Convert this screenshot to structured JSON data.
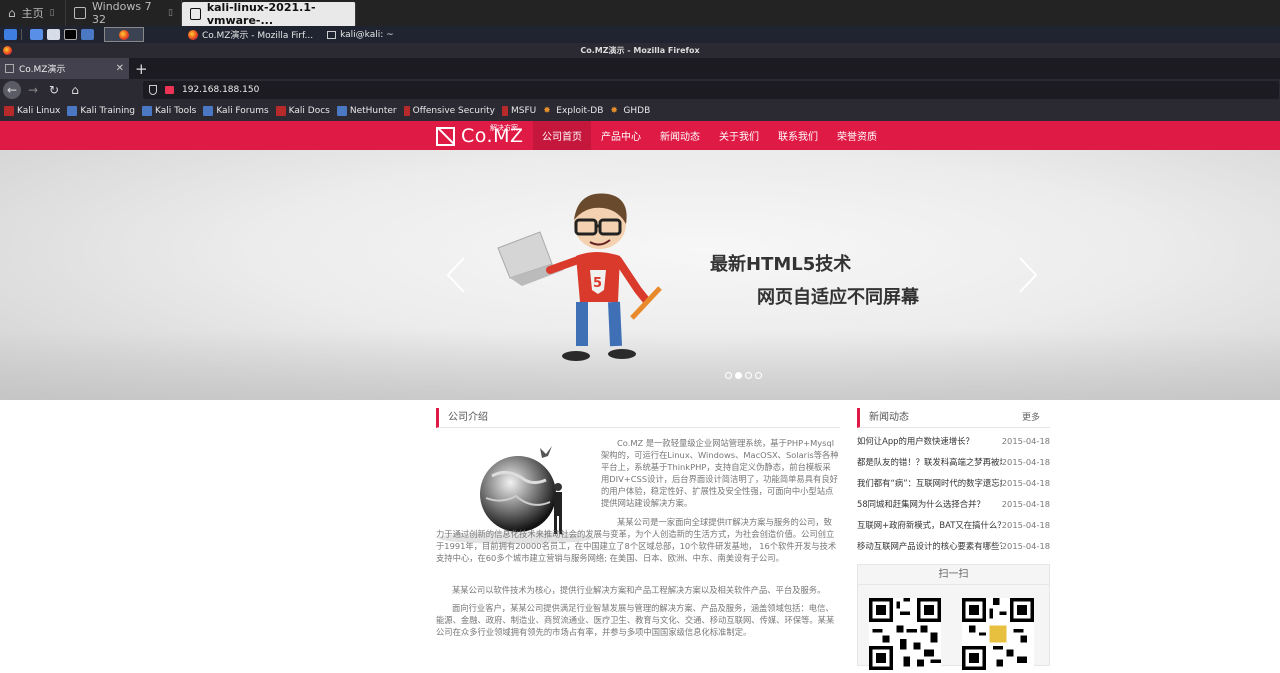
{
  "vm_tabs": [
    {
      "label": "主页"
    },
    {
      "label": "Windows 7 32"
    },
    {
      "label": "kali-linux-2021.1-vmware-..."
    }
  ],
  "taskbar": {
    "firefox_task": "Co.MZ演示 - Mozilla Firf...",
    "terminal_task": "kali@kali: ~"
  },
  "browser": {
    "window_title": "Co.MZ演示 - Mozilla Firefox",
    "tab_title": "Co.MZ演示",
    "url": "192.168.188.150",
    "bookmarks": [
      "Kali Linux",
      "Kali Training",
      "Kali Tools",
      "Kali Forums",
      "Kali Docs",
      "NetHunter",
      "Offensive Security",
      "MSFU",
      "Exploit-DB",
      "GHDB"
    ]
  },
  "site": {
    "logo_text": "Co.MZ",
    "logo_sub": "解决方案",
    "nav": [
      "公司首页",
      "产品中心",
      "新闻动态",
      "关于我们",
      "联系我们",
      "荣誉资质"
    ],
    "banner": {
      "line1": "最新HTML5技术",
      "line2": "网页自适应不同屏幕",
      "slide_count": 4,
      "active_slide": 2
    },
    "about": {
      "heading": "公司介绍",
      "p1": "Co.MZ 是一款轻量级企业网站管理系统，基于PHP+Mysql架构的，可运行在Linux、Windows、MacOSX、Solaris等各种平台上，系统基于ThinkPHP，支持自定义伪静态，前台模板采用DIV+CSS设计，后台界面设计简洁明了，功能简单易具有良好的用户体验，稳定性好、扩展性及安全性强，可面向中小型站点提供网站建设解决方案。",
      "p2": "某某公司是一家面向全球提供IT解决方案与服务的公司，致力于通过创新的信息化技术来推动社会的发展与变革，为个人创造新的生活方式，为社会创造价值。公司创立于1991年，目前拥有20000名员工，在中国建立了8个区域总部，10个软件研发基地， 16个软件开发与技术支持中心，在60多个城市建立营销与服务网络; 在美国、日本、欧洲、中东、南美设有子公司。",
      "p3": "某某公司以软件技术为核心，提供行业解决方案和产品工程解决方案以及相关软件产品、平台及服务。",
      "p4": "面向行业客户，某某公司提供满足行业智慧发展与管理的解决方案、产品及服务，涵盖领域包括：电信、能源、金融、政府、制造业、商贸流通业、医疗卫生、教育与文化、交通、移动互联网、传媒、环保等。某某公司在众多行业领域拥有领先的市场占有率，并参与多项中国国家级信息化标准制定。"
    },
    "news": {
      "heading": "新闻动态",
      "more": "更多",
      "items": [
        {
          "title": "如何让App的用户数快速增长？",
          "date": "2015-04-18"
        },
        {
          "title": "都是队友的错！？联发科高端之梦再被堵",
          "date": "2015-04-18"
        },
        {
          "title": "我们都有“病”：互联网时代的数字遗忘症",
          "date": "2015-04-18"
        },
        {
          "title": "58同城和赶集网为什么选择合并？",
          "date": "2015-04-18"
        },
        {
          "title": "互联网+政府新模式，BAT又在搞什么？",
          "date": "2015-04-18"
        },
        {
          "title": "移动互联网产品设计的核心要素有哪些？",
          "date": "2015-04-18"
        }
      ]
    },
    "scan": {
      "heading": "扫一扫"
    }
  },
  "colors": {
    "brand": "#df1a45",
    "brand_active": "#c5163c"
  }
}
